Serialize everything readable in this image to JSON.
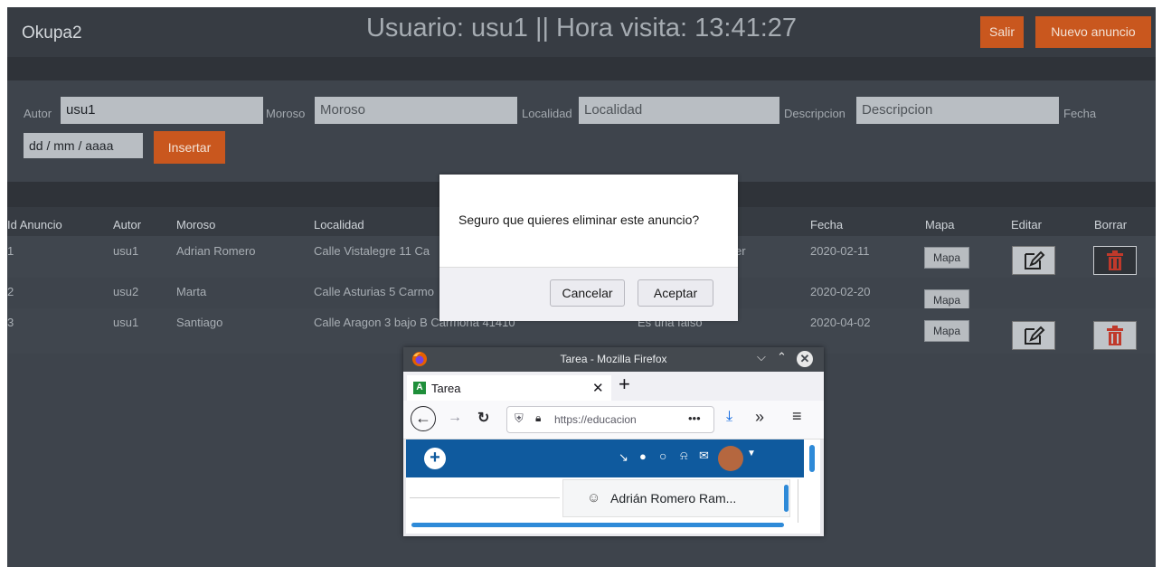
{
  "navbar": {
    "brand": "Okupa2",
    "title": "Usuario: usu1 || Hora visita: 13:41:27",
    "logout_label": "Salir",
    "new_ad_label": "Nuevo anuncio"
  },
  "form": {
    "autor_label": "Autor",
    "autor_value": "usu1",
    "moroso_label": "Moroso",
    "moroso_placeholder": "Moroso",
    "localidad_label": "Localidad",
    "localidad_placeholder": "Localidad",
    "descripcion_label": "Descripcion",
    "descripcion_placeholder": "Descripcion",
    "fecha_label": "Fecha",
    "fecha_placeholder": "dd / mm / aaaa",
    "submit_label": "Insertar"
  },
  "table": {
    "headers": [
      "Id Anuncio",
      "Autor",
      "Moroso",
      "Localidad",
      "Fecha",
      "Mapa",
      "Editar",
      "Borrar"
    ],
    "rows": [
      {
        "id": "1",
        "autor": "usu1",
        "moroso": "Adrian Romero",
        "localidad": "Calle Vistalegre 11 Ca",
        "descripcion": "er",
        "fecha": "2020-02-11",
        "mapa": "Mapa"
      },
      {
        "id": "2",
        "autor": "usu2",
        "moroso": "Marta",
        "localidad": "Calle Asturias 5 Carmo",
        "descripcion": "",
        "fecha": "2020-02-20",
        "mapa": "Mapa"
      },
      {
        "id": "3",
        "autor": "usu1",
        "moroso": "Santiago",
        "localidad": "Calle Aragon 3 bajo B Carmona 41410",
        "descripcion": "Es una falso",
        "fecha": "2020-04-02",
        "mapa": "Mapa"
      }
    ]
  },
  "dialog": {
    "message": "Seguro que quieres eliminar este anuncio?",
    "cancel_label": "Cancelar",
    "accept_label": "Aceptar"
  },
  "firefox": {
    "window_title": "Tarea - Mozilla Firefox",
    "tab_title": "Tarea",
    "url": "https://educacion",
    "user_menu_item": "Adrián Romero Ram..."
  },
  "colors": {
    "accent": "#c9571e",
    "background": "#3e444c",
    "navbar": "#373c43",
    "firefox_bluebar": "#0f5a9e"
  }
}
